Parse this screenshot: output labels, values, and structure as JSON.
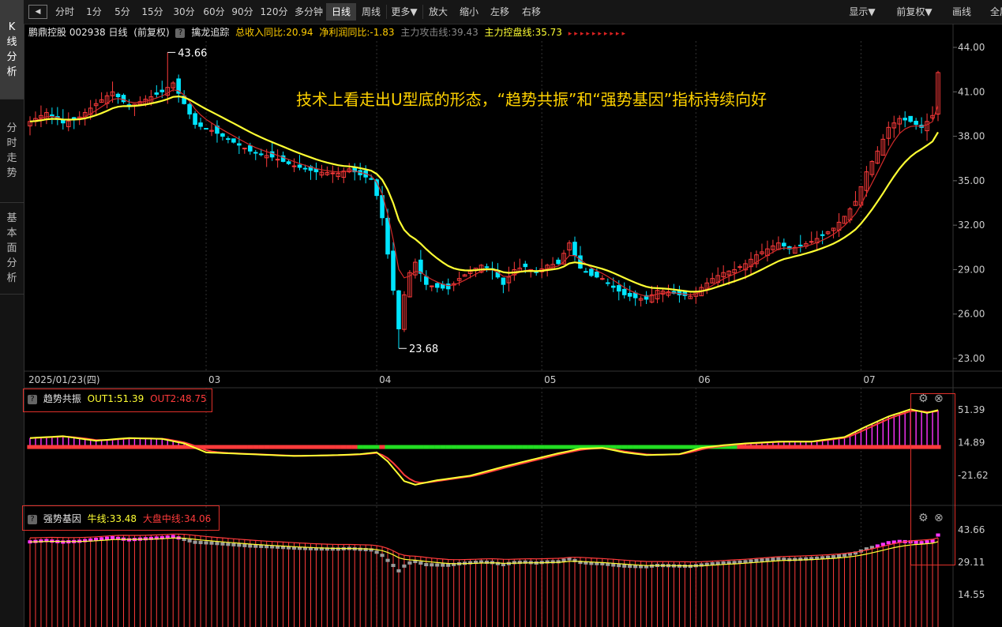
{
  "sidebar": {
    "tabs": [
      {
        "label": "K线分析",
        "active": true
      },
      {
        "label": "分时走势",
        "active": false
      },
      {
        "label": "基本面分析",
        "active": false
      }
    ]
  },
  "toolbar": {
    "back_label": "◀",
    "buttons": [
      "分时",
      "1分",
      "5分",
      "15分",
      "30分",
      "60分",
      "90分",
      "120分",
      "多分钟",
      "日线",
      "周线",
      "更多▼",
      "放大",
      "缩小",
      "左移",
      "右移"
    ],
    "active_button": "日线",
    "right_buttons": [
      "显示▼",
      "前复权▼",
      "画线",
      "全屏"
    ]
  },
  "info": {
    "stock": "鹏鼎控股 002938 日线",
    "adjust": "(前复权)",
    "indicator_name": "擒龙追踪",
    "revenue": "总收入同比:20.94",
    "profit": "净利润同比:-1.83",
    "attack": "主力攻击线:39.43",
    "control": "主力控盘线:35.73"
  },
  "colors": {
    "up": "#ff3b3b",
    "down": "#00e5ff",
    "ma_fast": "#d22a2a",
    "ma_slow": "#ffff33",
    "magenta": "#ff33ff",
    "green": "#22dd22",
    "grey": "#9a9a9a"
  },
  "annotation": "技术上看走出U型底的形态，“趋势共振”和“强势基因”指标持续向好",
  "chart_data": [
    {
      "type": "candlestick",
      "title": "鹏鼎控股 002938 日线",
      "date_label": "2025/01/23(四)",
      "x_ticks": [
        {
          "index": 32,
          "label": "03"
        },
        {
          "index": 63,
          "label": "04"
        },
        {
          "index": 93,
          "label": "05"
        },
        {
          "index": 121,
          "label": "06"
        },
        {
          "index": 151,
          "label": "07"
        }
      ],
      "ylim": [
        23.0,
        44.0
      ],
      "y_ticks": [
        44.0,
        41.0,
        38.0,
        35.0,
        32.0,
        29.0,
        26.0,
        23.0
      ],
      "y_tick_labels": [
        "44.00",
        "41.00",
        "38.00",
        "35.00",
        "32.00",
        "29.00",
        "26.00",
        "23.00"
      ],
      "high_label": "43.66",
      "low_label": "23.68",
      "high_index": 25,
      "low_index": 67,
      "close_anchors": [
        [
          0,
          39.0
        ],
        [
          3,
          39.6
        ],
        [
          6,
          38.9
        ],
        [
          9,
          39.3
        ],
        [
          12,
          40.2
        ],
        [
          15,
          41.0
        ],
        [
          18,
          40.0
        ],
        [
          21,
          40.5
        ],
        [
          24,
          41.0
        ],
        [
          26,
          41.6
        ],
        [
          28,
          40.2
        ],
        [
          30,
          38.8
        ],
        [
          33,
          38.4
        ],
        [
          36,
          37.8
        ],
        [
          40,
          37.0
        ],
        [
          44,
          36.6
        ],
        [
          48,
          36.0
        ],
        [
          52,
          35.6
        ],
        [
          56,
          35.5
        ],
        [
          58,
          35.8
        ],
        [
          60,
          35.4
        ],
        [
          62,
          35.1
        ],
        [
          63,
          34.0
        ],
        [
          64,
          32.5
        ],
        [
          66,
          27.6
        ],
        [
          67,
          25.0
        ],
        [
          68,
          27.3
        ],
        [
          69,
          28.8
        ],
        [
          70,
          29.5
        ],
        [
          72,
          28.0
        ],
        [
          74,
          27.8
        ],
        [
          76,
          27.7
        ],
        [
          78,
          28.4
        ],
        [
          80,
          28.9
        ],
        [
          82,
          29.3
        ],
        [
          84,
          29.0
        ],
        [
          86,
          28.0
        ],
        [
          88,
          29.0
        ],
        [
          90,
          29.2
        ],
        [
          92,
          28.8
        ],
        [
          94,
          29.3
        ],
        [
          96,
          29.4
        ],
        [
          98,
          30.8
        ],
        [
          100,
          29.1
        ],
        [
          102,
          28.6
        ],
        [
          104,
          28.4
        ],
        [
          106,
          27.8
        ],
        [
          108,
          27.3
        ],
        [
          110,
          27.1
        ],
        [
          112,
          27.0
        ],
        [
          114,
          27.6
        ],
        [
          116,
          27.5
        ],
        [
          118,
          27.3
        ],
        [
          120,
          27.2
        ],
        [
          122,
          27.8
        ],
        [
          124,
          28.4
        ],
        [
          126,
          28.8
        ],
        [
          128,
          29.0
        ],
        [
          130,
          29.4
        ],
        [
          132,
          30.0
        ],
        [
          134,
          30.4
        ],
        [
          136,
          30.8
        ],
        [
          138,
          30.4
        ],
        [
          140,
          30.6
        ],
        [
          142,
          30.9
        ],
        [
          144,
          31.3
        ],
        [
          146,
          31.8
        ],
        [
          148,
          32.6
        ],
        [
          150,
          33.6
        ],
        [
          152,
          35.6
        ],
        [
          154,
          37.0
        ],
        [
          156,
          38.6
        ],
        [
          158,
          39.2
        ],
        [
          160,
          39.0
        ],
        [
          162,
          38.6
        ],
        [
          164,
          39.4
        ],
        [
          165,
          42.3
        ]
      ],
      "series": [
        {
          "name": "主力攻击线",
          "value": 39.43
        },
        {
          "name": "主力控盘线",
          "value": 35.73
        }
      ]
    },
    {
      "type": "indicator",
      "title": "趋势共振",
      "series": [
        {
          "name": "OUT1",
          "value": 51.39
        },
        {
          "name": "OUT2",
          "value": 48.75
        }
      ],
      "y_ticks": [
        51.39,
        14.89,
        -21.62
      ],
      "y_tick_labels": [
        "51.39",
        "14.89",
        "-21.62"
      ],
      "curve_anchors": [
        [
          0,
          20
        ],
        [
          6,
          22
        ],
        [
          12,
          17
        ],
        [
          18,
          20
        ],
        [
          24,
          19
        ],
        [
          28,
          14
        ],
        [
          32,
          4
        ],
        [
          40,
          2
        ],
        [
          48,
          0
        ],
        [
          56,
          1
        ],
        [
          60,
          2
        ],
        [
          63,
          4
        ],
        [
          65,
          -6
        ],
        [
          68,
          -28
        ],
        [
          70,
          -32
        ],
        [
          74,
          -27
        ],
        [
          80,
          -22
        ],
        [
          86,
          -12
        ],
        [
          90,
          -6
        ],
        [
          96,
          3
        ],
        [
          100,
          8
        ],
        [
          104,
          9
        ],
        [
          108,
          4
        ],
        [
          112,
          1
        ],
        [
          118,
          2
        ],
        [
          122,
          9
        ],
        [
          126,
          12
        ],
        [
          130,
          14
        ],
        [
          136,
          16
        ],
        [
          142,
          16
        ],
        [
          148,
          21
        ],
        [
          152,
          33
        ],
        [
          156,
          44
        ],
        [
          160,
          52
        ],
        [
          163,
          48
        ],
        [
          165,
          51
        ]
      ],
      "baseline": 10.0
    },
    {
      "type": "indicator",
      "title": "强势基因",
      "series": [
        {
          "name": "牛线",
          "value": 33.48
        },
        {
          "name": "大盘中线",
          "value": 34.06
        }
      ],
      "y_ticks": [
        43.66,
        29.11,
        14.55
      ],
      "y_tick_labels": [
        "43.66",
        "29.11",
        "14.55"
      ]
    }
  ],
  "panel1_label": {
    "name": "趋势共振",
    "out1": "OUT1:51.39",
    "out2": "OUT2:48.75"
  },
  "panel2_label": {
    "name": "强势基因",
    "bull": "牛线:33.48",
    "mid": "大盘中线:34.06"
  }
}
